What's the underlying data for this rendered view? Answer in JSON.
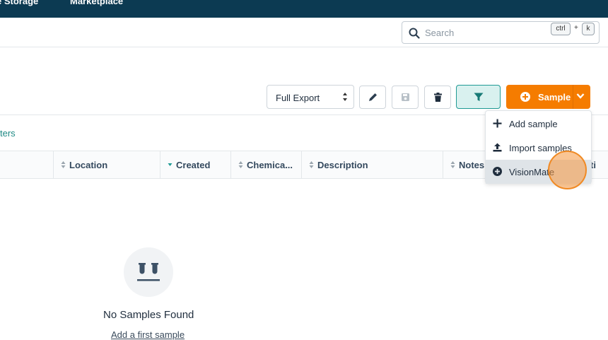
{
  "topnav": {
    "items": [
      "e Storage",
      "Marketplace"
    ]
  },
  "search": {
    "placeholder": "Search",
    "shortcut_key1": "ctrl",
    "shortcut_sep": "+",
    "shortcut_key2": "k"
  },
  "toolbar": {
    "export_select_value": "Full Export",
    "sample_button_label": "Sample"
  },
  "filters_link": "ters",
  "table": {
    "columns": [
      "Location",
      "Created",
      "Chemica...",
      "Description",
      "Notes",
      "ti"
    ]
  },
  "empty_state": {
    "title": "No Samples Found",
    "link": "Add a first sample"
  },
  "dropdown": {
    "items": [
      "Add sample",
      "Import samples",
      "VisionMate"
    ]
  },
  "colors": {
    "nav": "#0c3a52",
    "accent": "#f57c00",
    "teal": "#1f9a94"
  }
}
